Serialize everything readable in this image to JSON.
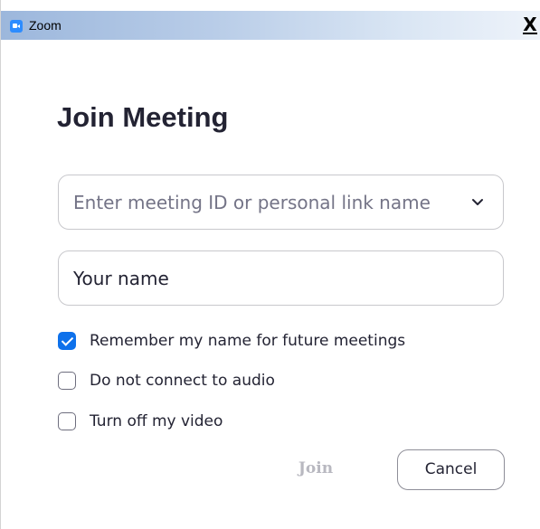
{
  "window": {
    "title": "Zoom",
    "close_symbol": "X",
    "app_icon": "zoom-app-icon"
  },
  "dialog": {
    "heading": "Join Meeting",
    "meeting_id_field": {
      "placeholder": "Enter meeting ID or personal link name",
      "value": "",
      "dropdown_icon": "chevron-down-icon"
    },
    "name_field": {
      "value": "Your name",
      "placeholder": ""
    },
    "options": [
      {
        "label": "Remember my name for future meetings",
        "checked": true
      },
      {
        "label": "Do not connect to audio",
        "checked": false
      },
      {
        "label": "Turn off my video",
        "checked": false
      }
    ],
    "buttons": {
      "join_label": "Join",
      "join_enabled": false,
      "cancel_label": "Cancel"
    }
  },
  "colors": {
    "accent": "#0e71eb",
    "heading_text": "#232333",
    "placeholder_text": "#747487",
    "disabled_text": "#b8b8c0"
  }
}
